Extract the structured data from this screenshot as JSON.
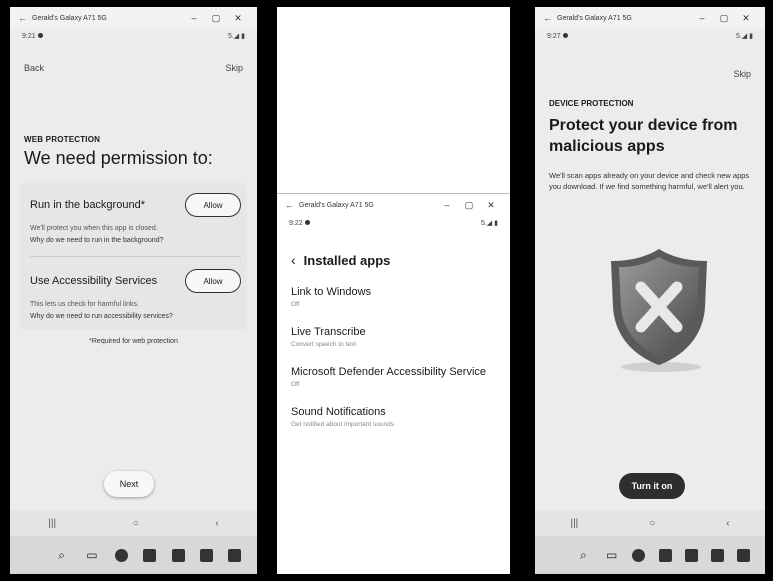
{
  "panel1": {
    "window_title": "Gerald's Galaxy A71 5G",
    "status_time": "9:21",
    "status_right": "5.◢ ▮",
    "back_label": "Back",
    "skip_label": "Skip",
    "section_label": "WEB PROTECTION",
    "title": "We need permission to:",
    "permissions": [
      {
        "title": "Run in the background*",
        "button": "Allow",
        "desc": "We'll protect you when this app is closed.",
        "link": "Why do we need to run in the background?"
      },
      {
        "title": "Use Accessibility Services",
        "button": "Allow",
        "desc": "This lets us check for harmful links.",
        "link": "Why do we need to run accessibility services?"
      }
    ],
    "footnote": "*Required for web protection",
    "next_label": "Next"
  },
  "panel2": {
    "window_title": "Gerald's Galaxy A71 5G",
    "status_time": "9:22",
    "status_right": "5.◢ ▮",
    "header": "Installed apps",
    "apps": [
      {
        "name": "Link to Windows",
        "sub": "Off"
      },
      {
        "name": "Live Transcribe",
        "sub": "Convert speech to text"
      },
      {
        "name": "Microsoft Defender Accessibility Service",
        "sub": "Off"
      },
      {
        "name": "Sound Notifications",
        "sub": "Get notified about important sounds"
      }
    ]
  },
  "panel3": {
    "window_title": "Gerald's Galaxy A71 5G",
    "status_time": "9:27",
    "status_right": "5.◢ ▮",
    "skip_label": "Skip",
    "section_label": "DEVICE PROTECTION",
    "title": "Protect your device from malicious apps",
    "desc": "We'll scan apps already on your device and check new apps you download. If we find something harmful, we'll alert you.",
    "button": "Turn it on"
  },
  "window_controls": {
    "back": "←",
    "minimize": "–",
    "maximize": "▢",
    "close": "✕"
  },
  "android_nav": {
    "recents": "|||",
    "home": "○",
    "back": "‹"
  },
  "taskbar_icons": [
    "windows-start-icon",
    "search-icon",
    "task-view-icon",
    "edge-icon",
    "store-icon",
    "app-icon",
    "outlook-icon",
    "phone-link-icon"
  ]
}
